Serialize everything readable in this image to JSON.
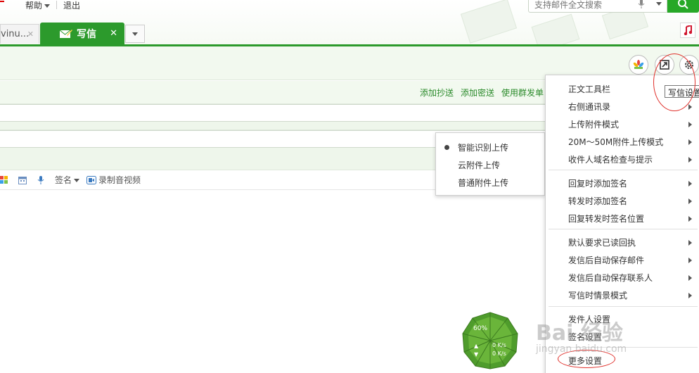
{
  "top_nav": {
    "help": "帮助",
    "logout": "退出"
  },
  "search": {
    "placeholder": "支持邮件全文搜索"
  },
  "tabs": {
    "previous": "vinu...",
    "compose": "写信"
  },
  "compose": {
    "add_cc": "添加抄送",
    "add_bcc": "添加密送",
    "group_send": "使用群发单",
    "toolbar": {
      "signature": "签名",
      "record_video": "录制音视频"
    }
  },
  "upload_submenu": {
    "items": [
      {
        "label": "智能识别上传",
        "selected": true
      },
      {
        "label": "云附件上传",
        "selected": false
      },
      {
        "label": "普通附件上传",
        "selected": false
      }
    ]
  },
  "settings_menu": {
    "tooltip": "写信设置",
    "items": [
      {
        "label": "正文工具栏",
        "submenu": false
      },
      {
        "label": "右侧通讯录",
        "submenu": true
      },
      {
        "label": "上传附件模式",
        "submenu": true
      },
      {
        "label": "20M～50M附件上传模式",
        "submenu": true
      },
      {
        "label": "收件人域名检查与提示",
        "submenu": true
      },
      {
        "label": "回复时添加签名",
        "submenu": true
      },
      {
        "label": "转发时添加签名",
        "submenu": true
      },
      {
        "label": "回复转发时签名位置",
        "submenu": true
      },
      {
        "label": "默认要求已读回执",
        "submenu": true
      },
      {
        "label": "发信后自动保存邮件",
        "submenu": true
      },
      {
        "label": "发信后自动保存联系人",
        "submenu": true
      },
      {
        "label": "写信时情景模式",
        "submenu": true
      },
      {
        "label": "发件人设置",
        "submenu": false
      },
      {
        "label": "签名设置",
        "submenu": false
      },
      {
        "label": "更多设置",
        "submenu": false
      }
    ]
  },
  "speed_widget": {
    "percent": "60%",
    "up_rate": "0 K/s",
    "down_rate": "0 K/s"
  },
  "watermark": {
    "text": "Bai 经验",
    "sub": "jingyan.baidu.com"
  },
  "colors": {
    "brand_green": "#2c9a2c",
    "link_green": "#2a8a2a",
    "highlight_ring": "#e0302b"
  }
}
